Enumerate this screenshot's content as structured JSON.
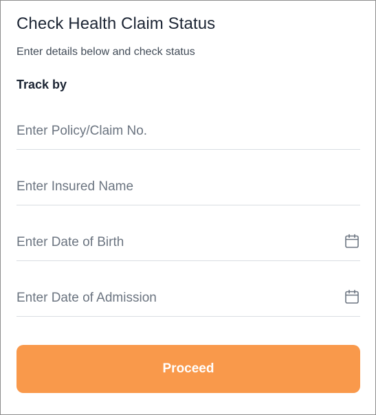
{
  "card": {
    "title": "Check Health Claim Status",
    "subtitle": "Enter details below and check status",
    "track_label": "Track by"
  },
  "fields": [
    {
      "placeholder": "Enter Policy/Claim No.",
      "value": "",
      "icon": null
    },
    {
      "placeholder": "Enter Insured Name",
      "value": "",
      "icon": null
    },
    {
      "placeholder": "Enter Date of Birth",
      "value": "",
      "icon": "calendar-icon"
    },
    {
      "placeholder": "Enter Date of Admission",
      "value": "",
      "icon": "calendar-icon"
    }
  ],
  "actions": {
    "proceed_label": "Proceed"
  },
  "colors": {
    "accent": "#f9994b",
    "title_text": "#1b2433",
    "placeholder_text": "#6b7480",
    "divider": "#d9dde2",
    "icon": "#6b7480"
  }
}
